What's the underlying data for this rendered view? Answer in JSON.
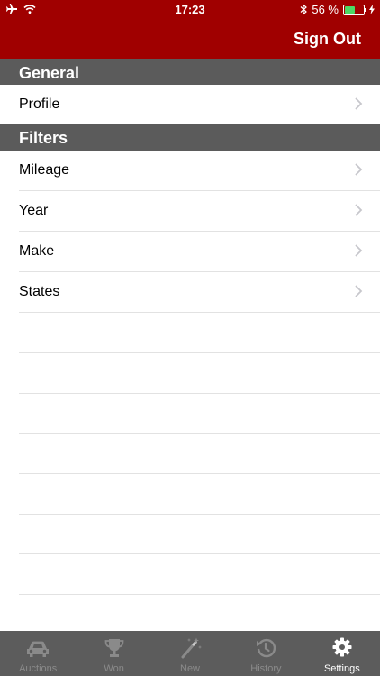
{
  "status": {
    "time": "17:23",
    "battery": "56 %",
    "battery_level": 0.56
  },
  "header": {
    "sign_out": "Sign Out"
  },
  "sections": {
    "general": {
      "title": "General",
      "items": [
        "Profile"
      ]
    },
    "filters": {
      "title": "Filters",
      "items": [
        "Mileage",
        "Year",
        "Make",
        "States"
      ]
    }
  },
  "tabs": [
    {
      "label": "Auctions",
      "icon": "car-icon"
    },
    {
      "label": "Won",
      "icon": "trophy-icon"
    },
    {
      "label": "New",
      "icon": "magic-wand-icon"
    },
    {
      "label": "History",
      "icon": "history-icon"
    },
    {
      "label": "Settings",
      "icon": "gear-icon",
      "active": true
    }
  ],
  "colors": {
    "accent": "#a00000",
    "section_bg": "#5b5b5b",
    "tabbar_bg": "#5c5c5c",
    "battery": "#4cd964"
  }
}
